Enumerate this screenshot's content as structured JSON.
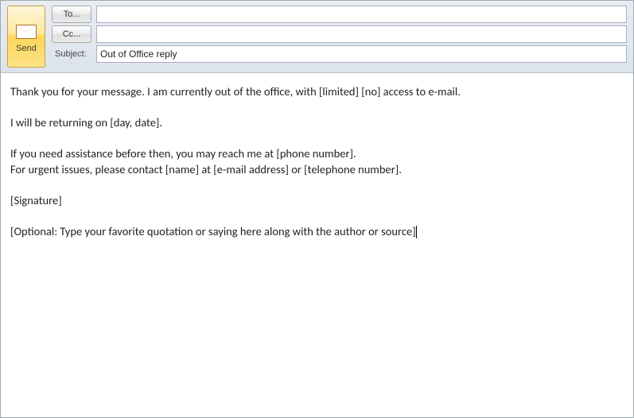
{
  "compose": {
    "send_label": "Send",
    "to_button": "To...",
    "cc_button": "Cc...",
    "subject_label": "Subject:",
    "to_value": "",
    "cc_value": "",
    "subject_value": "Out of Office reply"
  },
  "body": {
    "line1": "Thank you for your message. I am currently out of the office, with [limited] [no] access to e-mail.",
    "line2": "I will be returning on [day, date].",
    "line3": "If you need assistance before then, you may reach me at [phone number].",
    "line4": "For urgent issues, please contact [name] at [e-mail address] or [telephone number].",
    "line5": "[Signature]",
    "line6": "[Optional: Type your favorite quotation or saying here along with the author or source]"
  }
}
